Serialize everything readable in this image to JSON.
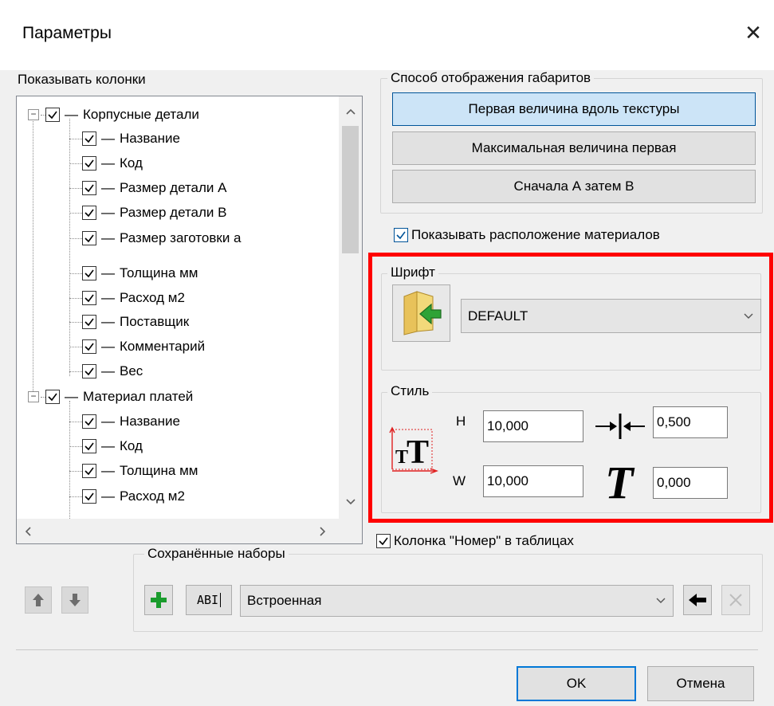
{
  "window": {
    "title": "Параметры"
  },
  "columns_group": {
    "label": "Показывать колонки",
    "tree": [
      {
        "label": "Корпусные детали",
        "level": 0,
        "checked": true,
        "expander": "⊟"
      },
      {
        "label": "Название",
        "level": 1,
        "checked": true
      },
      {
        "label": "Код",
        "level": 1,
        "checked": true
      },
      {
        "label": "Размер детали А",
        "level": 1,
        "checked": true
      },
      {
        "label": "Размер детали В",
        "level": 1,
        "checked": true
      },
      {
        "label": "Размер заготовки а",
        "level": 1,
        "checked": true
      },
      {
        "label": "Толщина мм",
        "level": 1,
        "checked": true
      },
      {
        "label": "Расход м2",
        "level": 1,
        "checked": true
      },
      {
        "label": "Поставщик",
        "level": 1,
        "checked": true
      },
      {
        "label": "Комментарий",
        "level": 1,
        "checked": true
      },
      {
        "label": "Вес",
        "level": 1,
        "checked": true
      },
      {
        "label": "Материал платей",
        "level": 0,
        "checked": true,
        "expander": "⊟"
      },
      {
        "label": "Название",
        "level": 1,
        "checked": true
      },
      {
        "label": "Код",
        "level": 1,
        "checked": true
      },
      {
        "label": "Толщина мм",
        "level": 1,
        "checked": true
      },
      {
        "label": "Расход м2",
        "level": 1,
        "checked": true
      }
    ]
  },
  "dimensions_group": {
    "label": "Способ отображения габаритов",
    "options": [
      {
        "label": "Первая величина вдоль текстуры",
        "selected": true
      },
      {
        "label": "Максимальная величина первая",
        "selected": false
      },
      {
        "label": "Сначала А затем В",
        "selected": false
      }
    ]
  },
  "show_materials": {
    "label": "Показывать расположение материалов",
    "checked": true
  },
  "font_group": {
    "label": "Шрифт",
    "font_value": "DEFAULT"
  },
  "style_group": {
    "label": "Стиль",
    "h_label": "H",
    "h_value": "10,000",
    "w_label": "W",
    "w_value": "10,000",
    "spacing_value": "0,500",
    "italic_value": "0,000"
  },
  "number_column": {
    "label": "Колонка \"Номер\" в таблицах",
    "checked": true
  },
  "saved_sets": {
    "label": "Сохранённые наборы",
    "selected": "Встроенная",
    "rename_icon_text": "ABI"
  },
  "buttons": {
    "ok": "OK",
    "cancel": "Отмена"
  },
  "colors": {
    "highlight": "#ff0000",
    "accent": "#0078d7",
    "add_icon": "#1a9c2d"
  }
}
